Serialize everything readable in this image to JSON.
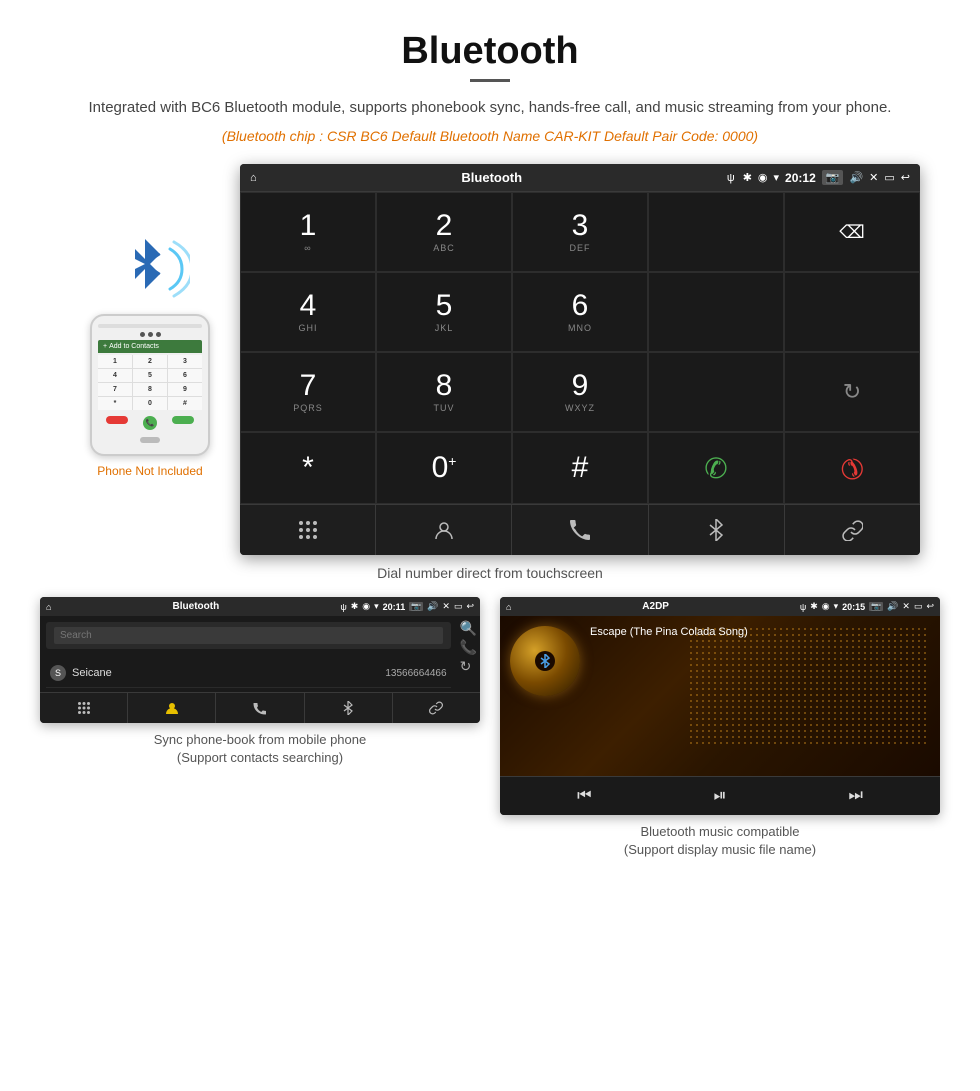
{
  "header": {
    "title": "Bluetooth",
    "description": "Integrated with BC6 Bluetooth module, supports phonebook sync, hands-free call, and music streaming from your phone.",
    "specs": "(Bluetooth chip : CSR BC6    Default Bluetooth Name CAR-KIT    Default Pair Code: 0000)"
  },
  "main_screen": {
    "status_bar": {
      "home_icon": "⌂",
      "title": "Bluetooth",
      "usb_icon": "ψ",
      "bt_icon": "✱",
      "location_icon": "◉",
      "signal_icon": "▾",
      "time": "20:12",
      "camera_icon": "📷",
      "volume_icon": "🔊",
      "close_icon": "✕",
      "window_icon": "▭",
      "back_icon": "↩"
    },
    "dialpad": {
      "rows": [
        [
          {
            "num": "1",
            "letters": "∞",
            "type": "digit"
          },
          {
            "num": "2",
            "letters": "ABC",
            "type": "digit"
          },
          {
            "num": "3",
            "letters": "DEF",
            "type": "digit"
          },
          {
            "num": "",
            "letters": "",
            "type": "empty"
          },
          {
            "num": "⌫",
            "letters": "",
            "type": "backspace"
          }
        ],
        [
          {
            "num": "4",
            "letters": "GHI",
            "type": "digit"
          },
          {
            "num": "5",
            "letters": "JKL",
            "type": "digit"
          },
          {
            "num": "6",
            "letters": "MNO",
            "type": "digit"
          },
          {
            "num": "",
            "letters": "",
            "type": "empty"
          },
          {
            "num": "",
            "letters": "",
            "type": "empty"
          }
        ],
        [
          {
            "num": "7",
            "letters": "PQRS",
            "type": "digit"
          },
          {
            "num": "8",
            "letters": "TUV",
            "type": "digit"
          },
          {
            "num": "9",
            "letters": "WXYZ",
            "type": "digit"
          },
          {
            "num": "",
            "letters": "",
            "type": "empty"
          },
          {
            "num": "↻",
            "letters": "",
            "type": "refresh"
          }
        ],
        [
          {
            "num": "*",
            "letters": "",
            "type": "digit"
          },
          {
            "num": "0",
            "letters": "+",
            "type": "zero"
          },
          {
            "num": "#",
            "letters": "",
            "type": "digit"
          },
          {
            "num": "📞",
            "letters": "",
            "type": "call-green"
          },
          {
            "num": "📞",
            "letters": "",
            "type": "call-red"
          }
        ]
      ]
    },
    "toolbar": {
      "buttons": [
        "⠿",
        "👤",
        "📞",
        "✱",
        "🔗"
      ]
    }
  },
  "main_caption": "Dial number direct from touchscreen",
  "phone_label": "Phone Not Included",
  "phonebook_screen": {
    "status_bar": {
      "home": "⌂",
      "title": "Bluetooth",
      "usb": "ψ",
      "bt": "✱",
      "location": "◉",
      "signal": "▾",
      "time": "20:11",
      "camera": "📷",
      "volume": "🔊",
      "close": "✕",
      "window": "▭",
      "back": "↩"
    },
    "search_placeholder": "Search",
    "contacts": [
      {
        "letter": "S",
        "name": "Seicane",
        "number": "13566664466"
      }
    ],
    "sidebar_icons": [
      "🔍",
      "📞",
      "↻"
    ],
    "toolbar_buttons": [
      "⠿",
      "👤",
      "📞",
      "✱",
      "🔗"
    ]
  },
  "phonebook_caption": "Sync phone-book from mobile phone\n(Support contacts searching)",
  "music_screen": {
    "status_bar": {
      "home": "⌂",
      "title": "A2DP",
      "usb": "ψ",
      "bt": "✱",
      "location": "◉",
      "signal": "▾",
      "time": "20:15",
      "camera": "📷",
      "volume": "🔊",
      "close": "✕",
      "window": "▭",
      "back": "↩"
    },
    "song_title": "Escape (The Pina Colada Song)",
    "controls": [
      "⏮",
      "⏯",
      "⏭"
    ]
  },
  "music_caption": "Bluetooth music compatible\n(Support display music file name)"
}
